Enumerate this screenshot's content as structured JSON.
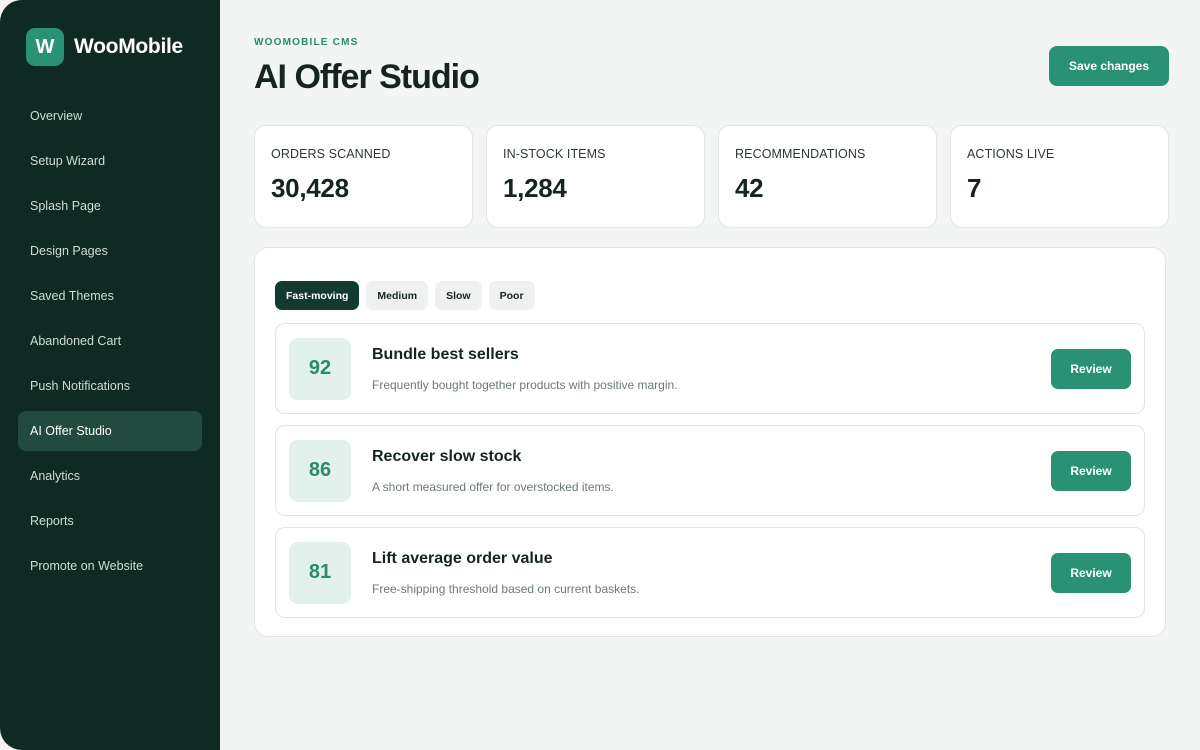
{
  "brand": {
    "logo_letter": "W",
    "name": "WooMobile"
  },
  "sidebar": {
    "items": [
      {
        "label": "Overview"
      },
      {
        "label": "Setup Wizard"
      },
      {
        "label": "Splash Page"
      },
      {
        "label": "Design Pages"
      },
      {
        "label": "Saved Themes"
      },
      {
        "label": "Abandoned Cart"
      },
      {
        "label": "Push Notifications"
      },
      {
        "label": "AI Offer Studio",
        "active": true
      },
      {
        "label": "Analytics"
      },
      {
        "label": "Reports"
      },
      {
        "label": "Promote on Website"
      }
    ]
  },
  "header": {
    "eyebrow": "WOOMOBILE CMS",
    "title": "AI Offer Studio",
    "save_label": "Save changes"
  },
  "stats": [
    {
      "label": "ORDERS SCANNED",
      "value": "30,428"
    },
    {
      "label": "IN-STOCK ITEMS",
      "value": "1,284"
    },
    {
      "label": "RECOMMENDATIONS",
      "value": "42"
    },
    {
      "label": "ACTIONS LIVE",
      "value": "7"
    }
  ],
  "filters": [
    {
      "label": "Fast-moving",
      "active": true
    },
    {
      "label": "Medium"
    },
    {
      "label": "Slow"
    },
    {
      "label": "Poor"
    }
  ],
  "offers": [
    {
      "score": "92",
      "title": "Bundle best sellers",
      "description": "Frequently bought together products with positive margin.",
      "action": "Review"
    },
    {
      "score": "86",
      "title": "Recover slow stock",
      "description": "A short measured offer for overstocked items.",
      "action": "Review"
    },
    {
      "score": "81",
      "title": "Lift average order value",
      "description": "Free-shipping threshold based on current baskets.",
      "action": "Review"
    }
  ],
  "colors": {
    "sidebar_bg": "#0f2a22",
    "accent": "#2a9274",
    "active_chip": "#123a30",
    "score_bg": "#e3f1ec"
  }
}
